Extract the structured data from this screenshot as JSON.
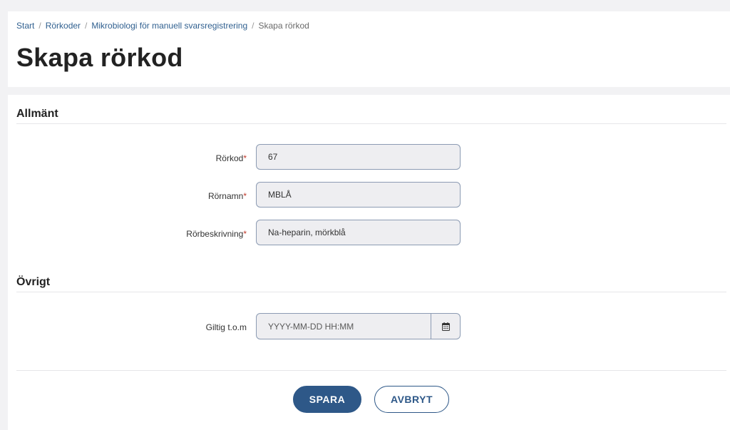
{
  "breadcrumb": {
    "items": [
      "Start",
      "Rörkoder",
      "Mikrobiologi för manuell svarsregistrering"
    ],
    "current": "Skapa rörkod"
  },
  "page": {
    "title": "Skapa rörkod"
  },
  "sections": {
    "general": {
      "title": "Allmänt",
      "fields": {
        "tube_code": {
          "label": "Rörkod",
          "required_mark": "*",
          "value": "67"
        },
        "tube_name": {
          "label": "Rörnamn",
          "required_mark": "*",
          "value": "MBLÅ"
        },
        "tube_description": {
          "label": "Rörbeskrivning",
          "required_mark": "*",
          "value": "Na-heparin, mörkblå"
        }
      }
    },
    "other": {
      "title": "Övrigt",
      "fields": {
        "valid_until": {
          "label": "Giltig t.o.m",
          "placeholder": "YYYY-MM-DD HH:MM",
          "value": "",
          "icon": "calendar-icon"
        }
      }
    }
  },
  "actions": {
    "save_label": "SPARA",
    "cancel_label": "AVBRYT"
  },
  "colors": {
    "primary": "#2e5888",
    "link": "#2f5f8f",
    "required": "#c0392b",
    "input_bg": "#eeeef1",
    "input_border": "#8c9bb3",
    "page_bg": "#f2f2f4"
  }
}
